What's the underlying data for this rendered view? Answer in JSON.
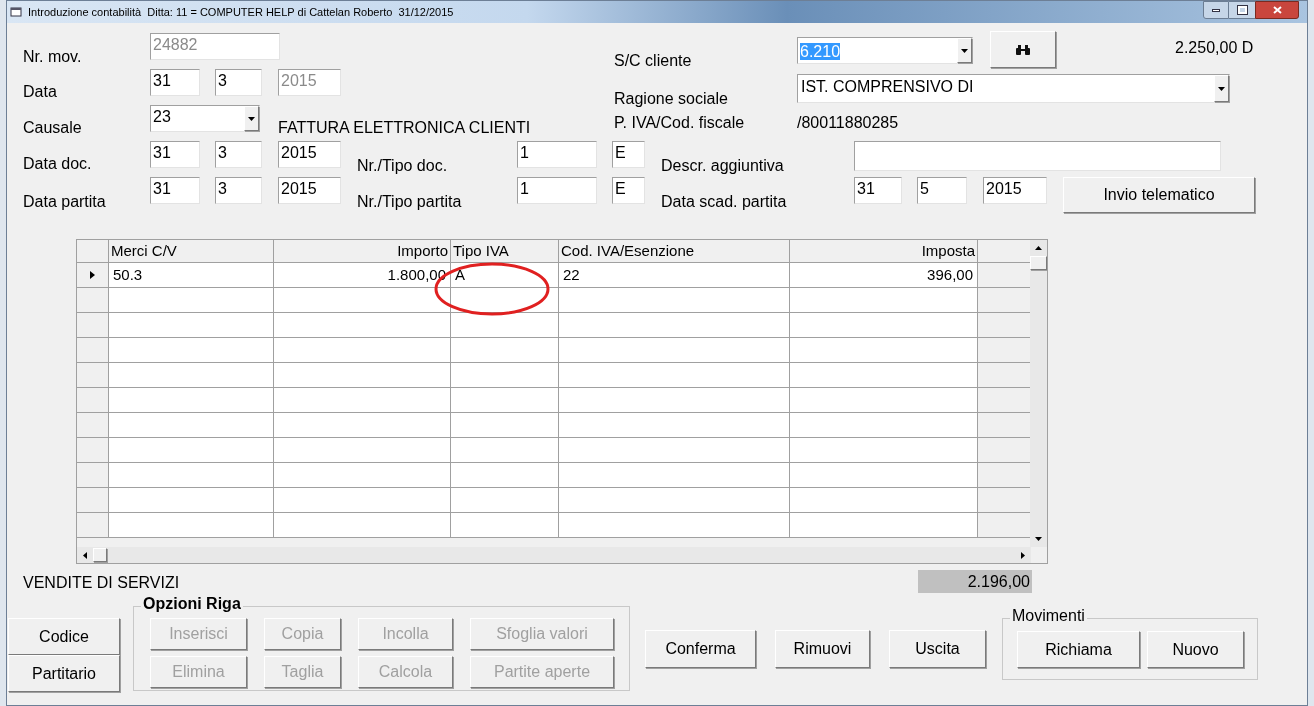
{
  "window": {
    "title": "Introduzione contabilità  Ditta: 11 = COMPUTER HELP di Cattelan Roberto  31/12/2015"
  },
  "form": {
    "nr_mov": {
      "label": "Nr. mov.",
      "value": "24882",
      "disabled": true
    },
    "data": {
      "label": "Data",
      "fields": [
        {
          "value": "31",
          "disabled": false
        },
        {
          "value": "3",
          "disabled": false
        },
        {
          "value": "2015",
          "disabled": true
        }
      ]
    },
    "causale": {
      "label": "Causale",
      "value": "23",
      "description": "FATTURA ELETTRONICA CLIENTI"
    },
    "data_doc": {
      "label": "Data doc.",
      "fields": [
        {
          "value": "31",
          "disabled": false
        },
        {
          "value": "3",
          "disabled": false
        },
        {
          "value": "2015",
          "disabled": false
        }
      ]
    },
    "nr_tipo_doc": {
      "label": "Nr./Tipo doc.",
      "number": "1",
      "type": "E"
    },
    "descr_aggiuntiva": {
      "label": "Descr. aggiuntiva"
    },
    "data_partita": {
      "label": "Data partita",
      "fields": [
        {
          "value": "31",
          "disabled": false
        },
        {
          "value": "3",
          "disabled": false
        },
        {
          "value": "2015",
          "disabled": false
        }
      ]
    },
    "nr_tipo_partita": {
      "label": "Nr./Tipo partita",
      "number": "1",
      "type": "E"
    },
    "data_scad_partita": {
      "label": "Data scad. partita",
      "fields": [
        {
          "value": "31",
          "disabled": false
        },
        {
          "value": "5",
          "disabled": false
        },
        {
          "value": "2015",
          "disabled": false
        }
      ]
    },
    "invio_button": "Invio telematico",
    "cliente": {
      "label": "S/C cliente",
      "value": "6.210",
      "balance": "2.250,00 D"
    },
    "ragione_sociale": {
      "label": "Ragione sociale",
      "value": "IST. COMPRENSIVO DI"
    },
    "piva": {
      "label": "P. IVA/Cod. fiscale",
      "value": "/80011880285"
    }
  },
  "table": {
    "columns": [
      {
        "label": "Merci C/V"
      },
      {
        "label": "Importo"
      },
      {
        "label": "Tipo IVA"
      },
      {
        "label": "Cod. IVA/Esenzione"
      },
      {
        "label": "Imposta"
      }
    ],
    "rows": [
      {
        "cells": [
          "50.3",
          "1.800,00",
          "A",
          "22",
          "396,00"
        ],
        "selected": true
      }
    ]
  },
  "footer": {
    "account_description": "VENDITE DI SERVIZI",
    "total": "2.196,00"
  },
  "left_buttons": [
    "Codice",
    "Partitario"
  ],
  "row_options": {
    "title": "Opzioni Riga",
    "buttons": [
      {
        "label": "Inserisci",
        "disabled": true
      },
      {
        "label": "Copia",
        "disabled": true
      },
      {
        "label": "Incolla",
        "disabled": true
      },
      {
        "label": "Sfoglia valori",
        "disabled": true
      },
      {
        "label": "Elimina",
        "disabled": true
      },
      {
        "label": "Taglia",
        "disabled": true
      },
      {
        "label": "Calcola",
        "disabled": true
      },
      {
        "label": "Partite aperte",
        "disabled": true
      }
    ]
  },
  "actions": [
    "Conferma",
    "Rimuovi",
    "Uscita"
  ],
  "movimenti": {
    "title": "Movimenti",
    "buttons": [
      "Richiama",
      "Nuovo"
    ]
  }
}
